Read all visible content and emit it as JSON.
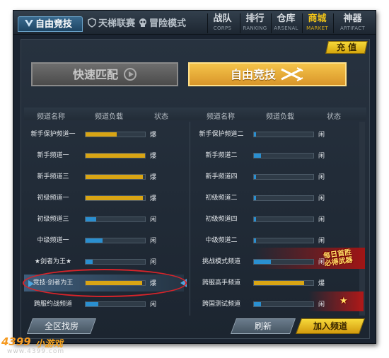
{
  "top_tabs": [
    {
      "label": "自由竞技",
      "active": true,
      "icon": "v-emblem-icon"
    },
    {
      "label": "天梯联赛",
      "active": false,
      "icon": "shield-icon"
    },
    {
      "label": "冒险模式",
      "active": false,
      "icon": "skull-icon"
    }
  ],
  "nav": [
    {
      "label": "战队",
      "sub": "CORPS",
      "active": false
    },
    {
      "label": "排行",
      "sub": "RANKING",
      "active": false
    },
    {
      "label": "仓库",
      "sub": "ARSENAL",
      "active": false
    },
    {
      "label": "商城",
      "sub": "MARKET",
      "active": true
    },
    {
      "label": "神器",
      "sub": "ARTIFACT",
      "active": false
    }
  ],
  "recharge_label": "充 值",
  "mode_buttons": {
    "quick_match": "快速匹配",
    "free_arena": "自由竞技"
  },
  "columns": {
    "name": "频道名称",
    "load": "频道负载",
    "status": "状态"
  },
  "colors": {
    "bar_gold": "#d9a514",
    "bar_blue": "#2a8fd0",
    "accent": "#f2c418",
    "highlight_oval": "#d8242a"
  },
  "left_channels": [
    {
      "name": "新手保护频道一",
      "load": 0.52,
      "color": "gold",
      "status": "爆"
    },
    {
      "name": "新手频道一",
      "load": 1.0,
      "color": "gold",
      "status": "爆"
    },
    {
      "name": "新手频道三",
      "load": 0.97,
      "color": "gold",
      "status": "爆"
    },
    {
      "name": "初级频道一",
      "load": 0.97,
      "color": "gold",
      "status": "爆"
    },
    {
      "name": "初级频道三",
      "load": 0.18,
      "color": "blue",
      "status": "闲"
    },
    {
      "name": "中级频道一",
      "load": 0.28,
      "color": "blue",
      "status": "闲"
    },
    {
      "name": "★剑者为王★",
      "load": 0.12,
      "color": "blue",
      "status": "闲"
    },
    {
      "name": "竞技·剑者为王",
      "load": 0.95,
      "color": "gold",
      "status": "爆"
    },
    {
      "name": "跨服约战频道",
      "load": 0.22,
      "color": "blue",
      "status": "闲"
    }
  ],
  "right_channels": [
    {
      "name": "新手保护频道二",
      "load": 0.03,
      "color": "blue",
      "status": "闲"
    },
    {
      "name": "新手频道二",
      "load": 0.12,
      "color": "blue",
      "status": "闲"
    },
    {
      "name": "新手频道四",
      "load": 0.03,
      "color": "blue",
      "status": "闲"
    },
    {
      "name": "初级频道二",
      "load": 0.03,
      "color": "blue",
      "status": "闲"
    },
    {
      "name": "初级频道四",
      "load": 0.03,
      "color": "blue",
      "status": "闲"
    },
    {
      "name": "中级频道二",
      "load": 0.03,
      "color": "blue",
      "status": "闲"
    },
    {
      "name": "挑战模式频道",
      "load": 0.28,
      "color": "blue",
      "status": "闲"
    },
    {
      "name": "跨服高手频道",
      "load": 0.85,
      "color": "gold",
      "status": "爆"
    },
    {
      "name": "跨国测试频道",
      "load": 0.12,
      "color": "blue",
      "status": "闲"
    }
  ],
  "promo_daily_line1": "每日首胜",
  "promo_daily_line2": "必得武器",
  "flag_star": "★",
  "bottom_buttons": {
    "find_room": "全区找房",
    "refresh": "刷新",
    "join": "加入频道"
  },
  "watermark": {
    "logo": "4399",
    "text": "小游戏",
    "url": "www.4399.com"
  }
}
